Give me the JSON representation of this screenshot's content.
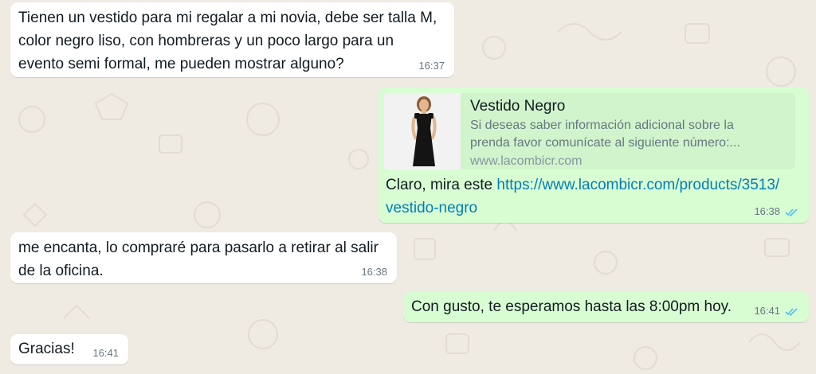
{
  "chat": {
    "messages": [
      {
        "direction": "incoming",
        "lines": [
          "Tienen un vestido para mi regalar a mi novia, debe ser talla M,",
          "color negro liso, con hombreras y un poco largo para un",
          "evento semi formal, me pueden mostrar alguno?"
        ],
        "time": "16:37"
      },
      {
        "direction": "outgoing",
        "preview": {
          "title": "Vestido Negro",
          "description_lines": [
            "Si deseas saber información adicional sobre la",
            "prenda favor comunícate al siguiente número:..."
          ],
          "domain": "www.lacombicr.com"
        },
        "text_prefix": "Claro, mira este ",
        "link_line1": "https://www.lacombicr.com/products/3513/",
        "link_line2": "vestido-negro",
        "time": "16:38",
        "status": "read"
      },
      {
        "direction": "incoming",
        "lines": [
          "me encanta, lo compraré para pasarlo a retirar al salir",
          "de la oficina."
        ],
        "time": "16:38"
      },
      {
        "direction": "outgoing",
        "text": "Con gusto, te esperamos hasta las 8:00pm hoy.",
        "time": "16:41",
        "status": "read"
      },
      {
        "direction": "incoming",
        "text": "Gracias!",
        "time": "16:41"
      }
    ]
  },
  "colors": {
    "background": "#efeae2",
    "incoming_bubble": "#ffffff",
    "outgoing_bubble": "#d9fdd3",
    "link": "#027eb5",
    "read_ticks": "#53bdeb"
  },
  "icons": [
    "double-check-icon"
  ]
}
